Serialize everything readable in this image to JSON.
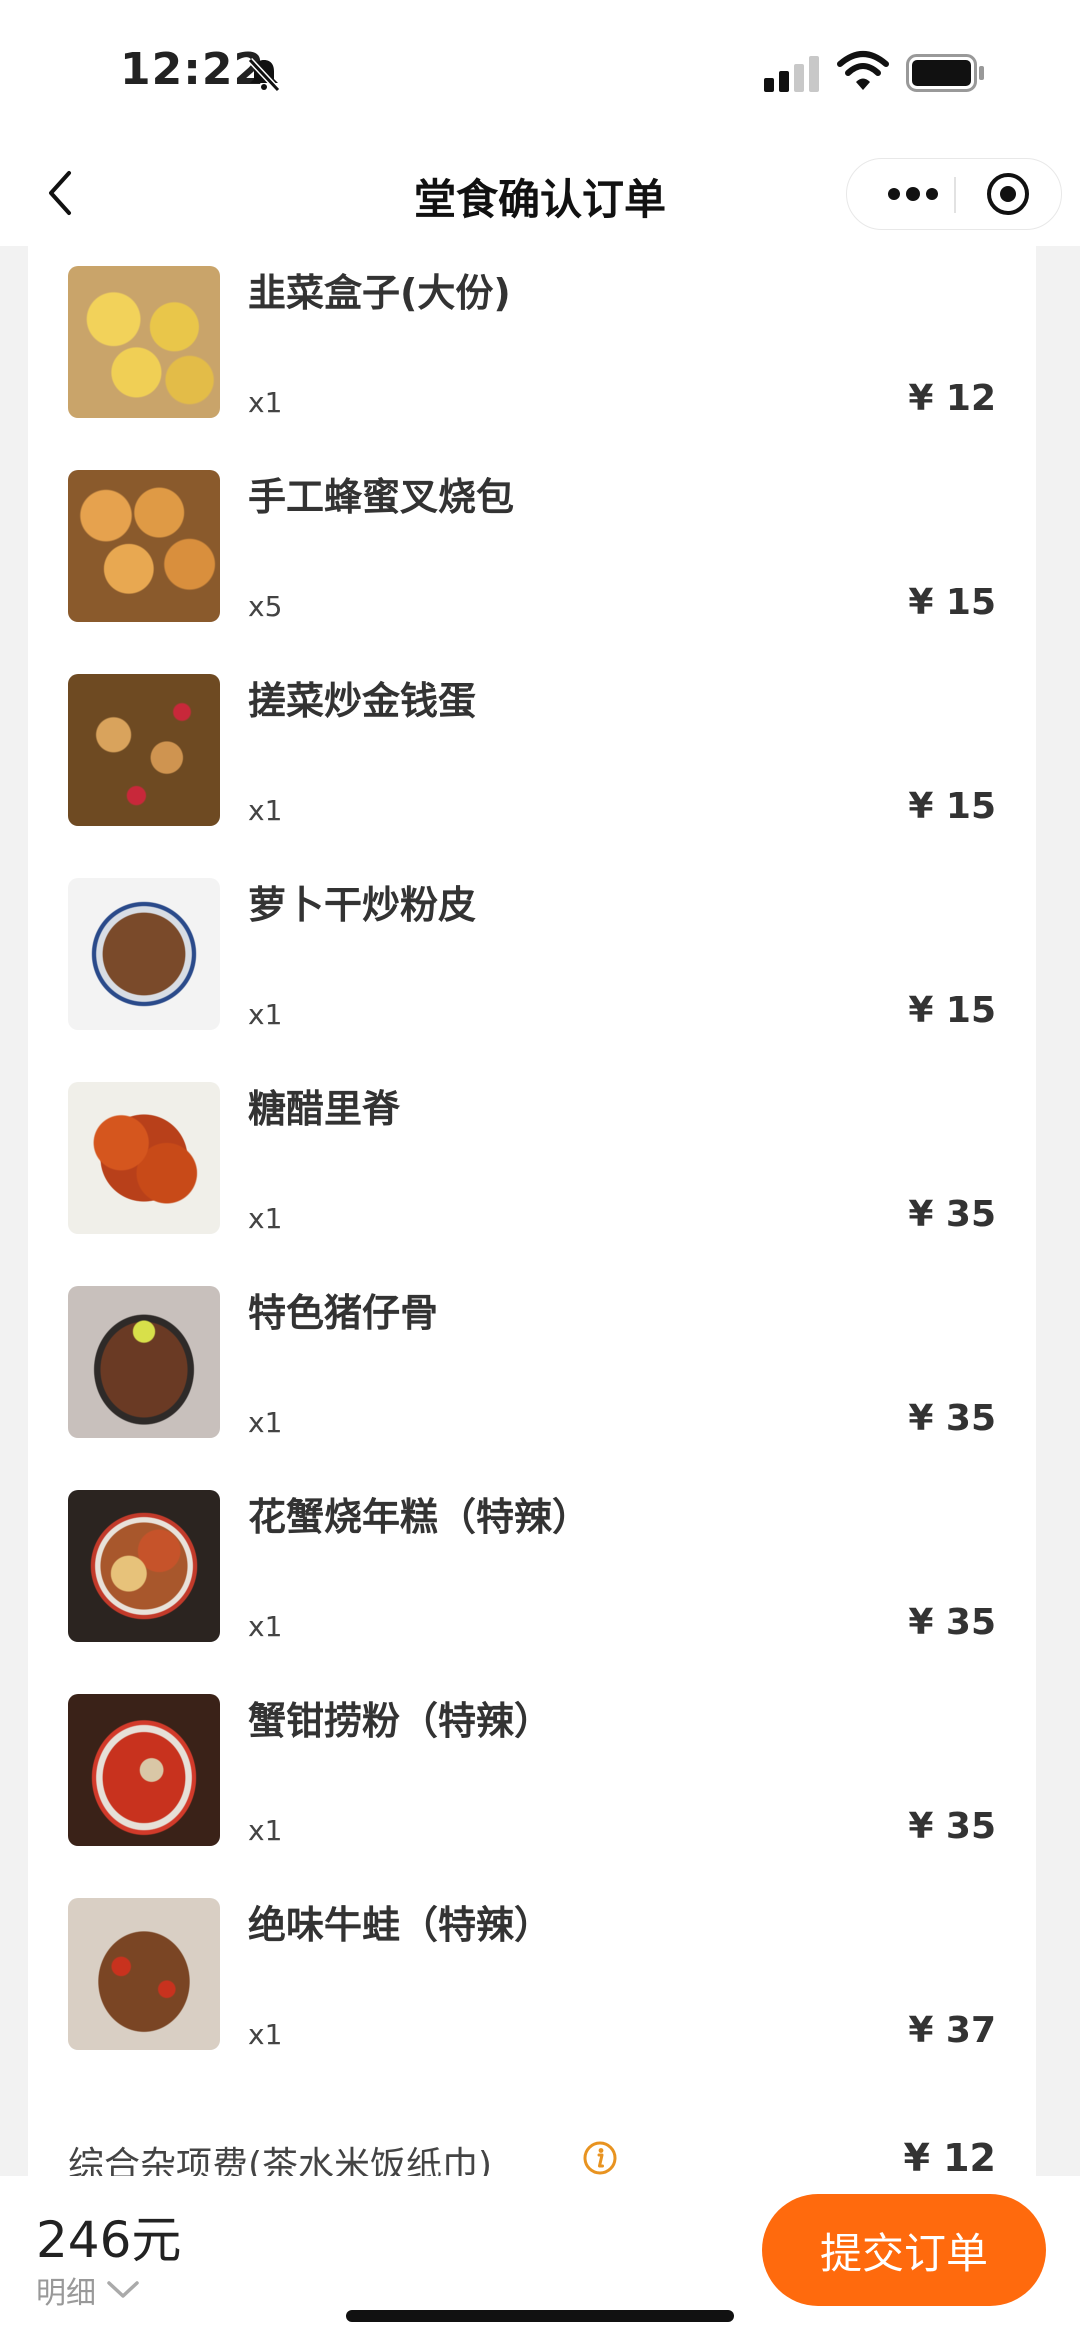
{
  "status": {
    "time": "12:22"
  },
  "nav": {
    "title": "堂食确认订单"
  },
  "items": [
    {
      "name": "韭菜盒子(大份)",
      "qty": "x1",
      "price": "¥ 12",
      "image": "chive-box-photo"
    },
    {
      "name": "手工蜂蜜叉烧包",
      "qty": "x5",
      "price": "¥ 15",
      "image": "bbq-pork-bun-photo"
    },
    {
      "name": "搓菜炒金钱蛋",
      "qty": "x1",
      "price": "¥ 15",
      "image": "egg-stir-fry-photo"
    },
    {
      "name": "萝卜干炒粉皮",
      "qty": "x1",
      "price": "¥ 15",
      "image": "radish-noodle-photo"
    },
    {
      "name": "糖醋里脊",
      "qty": "x1",
      "price": "¥ 35",
      "image": "sweet-sour-pork-photo"
    },
    {
      "name": "特色猪仔骨",
      "qty": "x1",
      "price": "¥ 35",
      "image": "pork-rib-photo"
    },
    {
      "name": "花蟹烧年糕（特辣）",
      "qty": "x1",
      "price": "¥ 35",
      "image": "crab-rice-cake-photo"
    },
    {
      "name": "蟹钳捞粉（特辣）",
      "qty": "x1",
      "price": "¥ 35",
      "image": "crab-claw-noodle-photo"
    },
    {
      "name": "绝味牛蛙（特辣）",
      "qty": "x1",
      "price": "¥ 37",
      "image": "bullfrog-photo"
    }
  ],
  "fee": {
    "label": "综合杂项费(茶水米饭纸巾)",
    "price": "¥ 12"
  },
  "footer": {
    "total": "246元",
    "detail_label": "明细",
    "submit_label": "提交订单"
  },
  "colors": {
    "accent": "#ff6a0d",
    "info_icon": "#e89320"
  }
}
